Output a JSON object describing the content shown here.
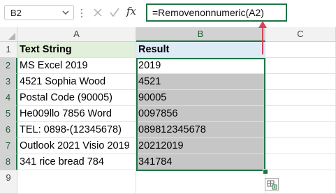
{
  "formula_bar": {
    "name_box": "B2",
    "fx_label": "fx",
    "formula": "=Removenonnumeric(A2)"
  },
  "columns": [
    "A",
    "B",
    "C"
  ],
  "rows": [
    "1",
    "2",
    "3",
    "4",
    "5",
    "6",
    "7",
    "8",
    "9"
  ],
  "table": {
    "header_a": "Text String",
    "header_b": "Result",
    "col_a": [
      "MS Excel 2019",
      "4521 Sophia Wood",
      "Postal Code (90005)",
      "He009llo 7856 Word",
      "TEL: 0898-(12345678)",
      "Outlook 2021 Visio 2019",
      "341 rice bread 784"
    ],
    "col_b": [
      "2019",
      "4521",
      "90005",
      "0097856",
      "089812345678",
      "20212019",
      "341784"
    ]
  },
  "colors": {
    "accent": "#217346",
    "header_a_fill": "#e2efda",
    "header_b_fill": "#ddebf7",
    "result_fill": "#c6c6c6",
    "arrow": "#d6435a"
  },
  "icons": [
    "chevron-down-icon",
    "cancel-icon",
    "enter-icon",
    "fx-icon",
    "quick-analysis-icon",
    "arrow-up-icon"
  ]
}
